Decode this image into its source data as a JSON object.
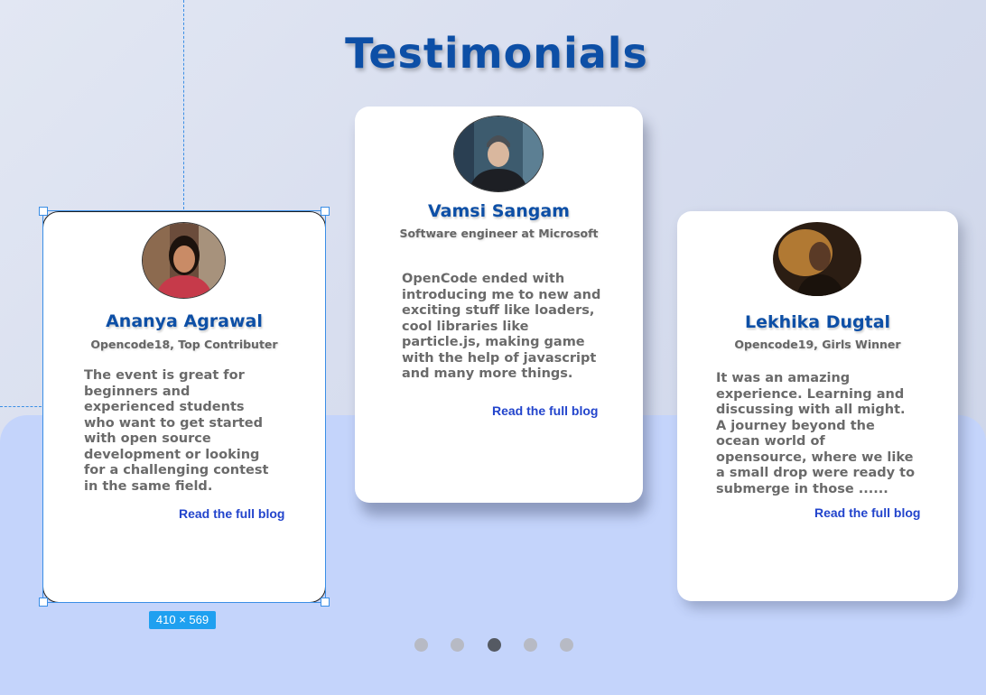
{
  "title": "Testimonials",
  "cards": [
    {
      "name": "Ananya Agrawal",
      "role": "Opencode18, Top Contributer",
      "quote": "The event is great for beginners and experienced students who want to get started with open source development or looking for a challenging contest in the same field.",
      "link": "Read the full blog"
    },
    {
      "name": "Vamsi Sangam",
      "role": "Software engineer at Microsoft",
      "quote": "OpenCode ended with introducing me to new and exciting stuff like loaders, cool libraries like particle.js, making game with the help of javascript and many more things.",
      "link": "Read the full blog"
    },
    {
      "name": "Lekhika Dugtal",
      "role": "Opencode19, Girls Winner",
      "quote": "It was an amazing experience. Learning and discussing with all might. A journey beyond the ocean world of opensource, where we like a small drop were ready to submerge in those ......",
      "link": "Read the full blog"
    }
  ],
  "selection": {
    "size_label": "410 × 569"
  },
  "pagination": {
    "count": 5,
    "active_index": 2
  },
  "colors": {
    "accent": "#0d4fa6",
    "link": "#2244cc",
    "band": "#c4d4fb",
    "selection": "#3a8ee6"
  }
}
